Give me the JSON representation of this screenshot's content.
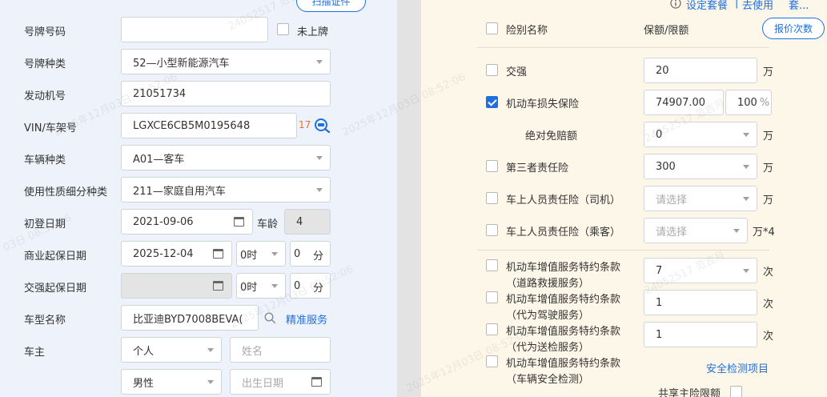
{
  "left": {
    "scan_button": "扫描证件",
    "plate_number": {
      "label": "号牌号码",
      "value": "",
      "unregistered_label": "未上牌"
    },
    "plate_type": {
      "label": "号牌种类",
      "value": "52—小型新能源汽车"
    },
    "engine_number": {
      "label": "发动机号",
      "value": "21051734"
    },
    "vin": {
      "label": "VIN/车架号",
      "value": "LGXCE6CB5M0195648",
      "count": "17"
    },
    "vehicle_type": {
      "label": "车辆种类",
      "value": "A01—客车"
    },
    "usage_type": {
      "label": "使用性质细分种类",
      "value": "211—家庭自用汽车"
    },
    "first_reg": {
      "label": "初登日期",
      "value": "2021-09-06",
      "age_label": "车龄",
      "age_value": "4"
    },
    "commercial_start": {
      "label": "商业起保日期",
      "date": "2025-12-04",
      "hour": "0时",
      "minute": "0",
      "minute_unit": "分"
    },
    "compulsory_start": {
      "label": "交强起保日期",
      "date": "",
      "hour": "0时",
      "minute": "0",
      "minute_unit": "分"
    },
    "model_name": {
      "label": "车型名称",
      "value": "比亚迪BYD7008BEVA(",
      "service_link": "精准服务"
    },
    "owner": {
      "label": "车主",
      "id_type": "个人",
      "name_placeholder": "姓名",
      "gender": "男性",
      "birth_placeholder": "出生日期"
    }
  },
  "right": {
    "top_links": {
      "set_package": "设定套餐",
      "separator": "|",
      "remove_use": "去使用",
      "more": "套..."
    },
    "header": {
      "name": "险别名称",
      "amount": "保额/限额",
      "quote_button": "报价次数"
    },
    "rows": [
      {
        "label": "交强",
        "value": "20",
        "unit": "万",
        "checked": false
      },
      {
        "label": "机动车损失保险",
        "value": "74907.00",
        "percent": "100",
        "percent_unit": "%",
        "checked": true
      },
      {
        "label": "绝对免赔额",
        "value": "0",
        "unit": "万"
      },
      {
        "label": "第三者责任险",
        "value": "300",
        "unit": "万",
        "checked": false
      },
      {
        "label": "车上人员责任险（司机）",
        "placeholder": "请选择",
        "unit": "万",
        "checked": false
      },
      {
        "label": "车上人员责任险（乘客）",
        "placeholder": "请选择",
        "unit": "万*4",
        "checked": false
      },
      {
        "label_line1": "机动车增值服务特约条款",
        "label_line2": "（道路救援服务）",
        "value": "7",
        "unit": "次",
        "checked": false
      },
      {
        "label_line1": "机动车增值服务特约条款",
        "label_line2": "（代为驾驶服务）",
        "value": "1",
        "unit": "次",
        "checked": false
      },
      {
        "label_line1": "机动车增值服务特约条款",
        "label_line2": "（代为送检服务）",
        "value": "1",
        "unit": "次",
        "checked": false
      },
      {
        "label_line1": "机动车增值服务特约条款",
        "label_line2": "（车辆安全检测）",
        "link": "安全检测项目",
        "checked": false
      }
    ],
    "shared_limit": "共享主险限额"
  },
  "watermarks": [
    "2025年12月03日 08:52:06",
    "24052517 范吉月",
    "03日 08:52:06"
  ],
  "colors": {
    "accent": "#1e6fe0",
    "left_bg": "#eef2fb",
    "right_bg": "#fdf7ea",
    "count": "#e8702a"
  }
}
